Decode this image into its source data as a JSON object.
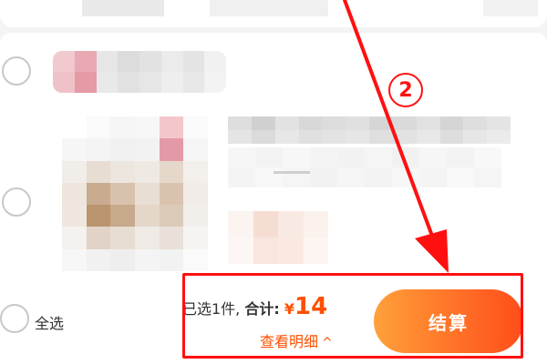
{
  "annotation": {
    "step_number": "2",
    "color": "#ff1010"
  },
  "cart": {
    "items_count_text": "已选1件,",
    "total_label": "合计:",
    "currency": "¥",
    "total_amount": "14",
    "view_details_label": "查看明细",
    "select_all_label": "全选",
    "checkout_label": "结算",
    "accent_color": "#ff5000"
  },
  "icons": {
    "radio": "radio-circle-icon",
    "chevron": "chevron-up-icon"
  }
}
